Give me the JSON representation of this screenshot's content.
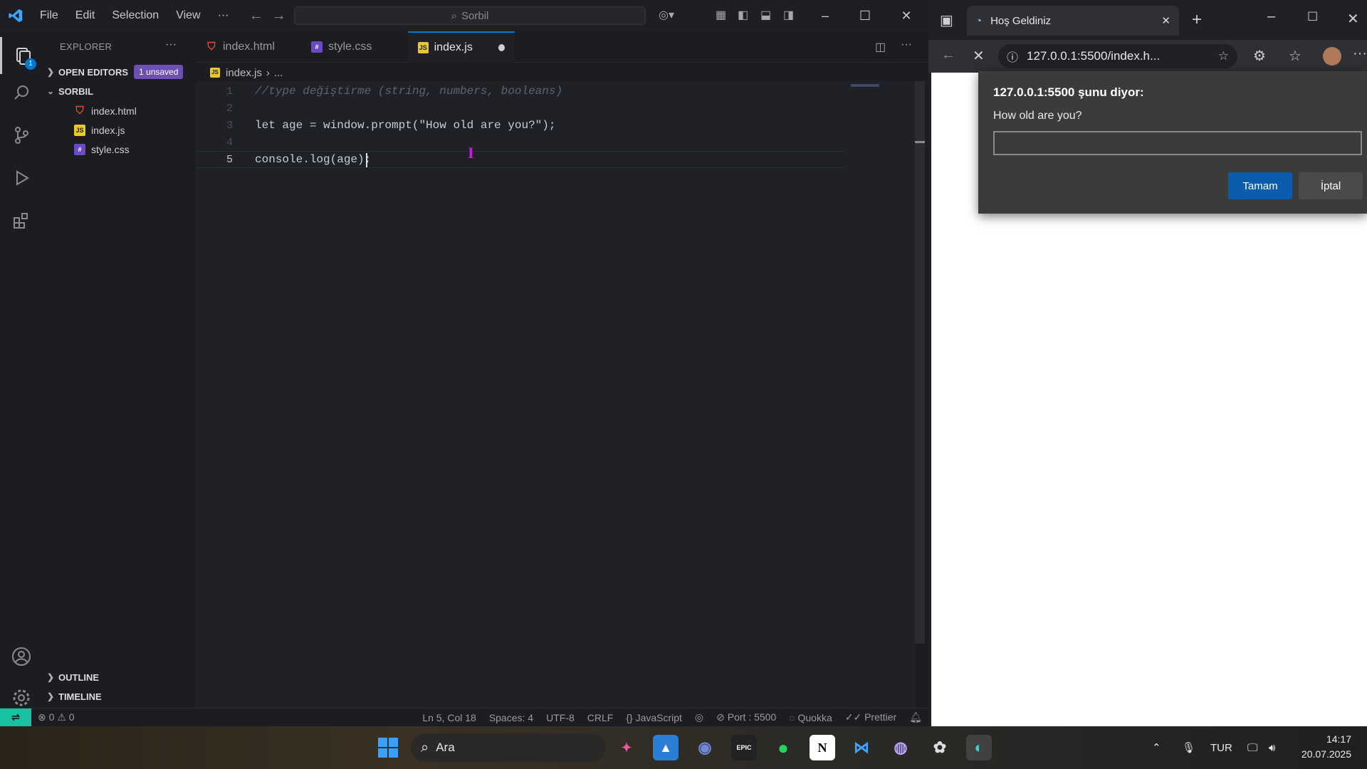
{
  "vscode": {
    "menu": [
      "File",
      "Edit",
      "Selection",
      "View",
      "···"
    ],
    "search_text": "Sorbil",
    "explorer_title": "EXPLORER",
    "explorer_more": "···",
    "open_editors_label": "OPEN EDITORS",
    "unsaved_badge": "1 unsaved",
    "folder_name": "SORBIL",
    "files": [
      "index.html",
      "index.js",
      "style.css"
    ],
    "outline_label": "OUTLINE",
    "timeline_label": "TIMELINE",
    "activity_badge": "1",
    "tabs": [
      "index.html",
      "style.css",
      "index.js"
    ],
    "breadcrumb": [
      "index.js",
      "..."
    ],
    "code_lines": [
      {
        "num": "1",
        "text": "//type değiştirme (string, numbers, booleans)"
      },
      {
        "num": "2",
        "text": ""
      },
      {
        "num": "3",
        "text": "let age = window.prompt(\"How old are you?\");"
      },
      {
        "num": "4",
        "text": ""
      },
      {
        "num": "5",
        "text": "console.log(age);"
      }
    ],
    "status": {
      "errors": "0",
      "warnings": "0",
      "position": "Ln 5, Col 18",
      "spaces": "Spaces: 4",
      "encoding": "UTF-8",
      "eol": "CRLF",
      "language": "JavaScript",
      "port": "Port : 5500",
      "quokka": "Quokka",
      "prettier": "Prettier"
    }
  },
  "browser": {
    "tab_title": "Hoş Geldiniz",
    "address": "127.0.0.1:5500/index.h...",
    "dialog": {
      "title": "127.0.0.1:5500 şunu diyor:",
      "message": "How old are you?",
      "input_value": "",
      "ok_label": "Tamam",
      "cancel_label": "İptal"
    }
  },
  "taskbar": {
    "search_text": "Ara",
    "language": "TUR",
    "time": "14:17",
    "date": "20.07.2025",
    "apps": [
      "windows-start",
      "paint",
      "photos",
      "discord",
      "epic-games",
      "spotify",
      "notion",
      "vscode",
      "github",
      "chatgpt",
      "edge"
    ]
  },
  "colors": {
    "accent_blue": "#0078d4",
    "remote_green": "#16c2a1",
    "unsaved_purple": "#6e4fb3",
    "dialog_ok": "#0b5cad"
  }
}
